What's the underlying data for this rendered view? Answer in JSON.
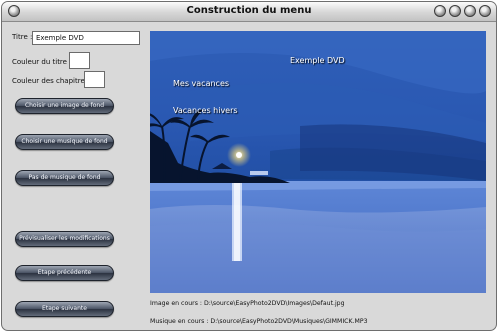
{
  "window": {
    "title": "Construction du menu"
  },
  "form": {
    "titre_label": "Titre :",
    "titre_value": "Exemple DVD",
    "couleur_titre_label": "Couleur du titre :",
    "couleur_chapitres_label": "Couleur des chapitres :",
    "couleur_titre_value": "#ffffff",
    "couleur_chapitres_value": "#ffffff"
  },
  "buttons": {
    "choose_image": "Choisir une image de fond",
    "choose_music": "Choisir une musique de fond",
    "no_music": "Pas de musique de fond",
    "preview": "Prévisualiser les modifications",
    "prev_step": "Etape précédente",
    "next_step": "Etape suivante"
  },
  "preview": {
    "menu_title": "Exemple DVD",
    "chapters": [
      "Mes vacances",
      "Vacances hivers"
    ]
  },
  "status": {
    "image_label": "Image en cours :",
    "image_path": "D:\\source\\EasyPhoto2DVD\\Images\\Defaut.jpg",
    "music_label": "Musique en cours :",
    "music_path": "D:\\source\\EasyPhoto2DVD\\Musiques\\GIMMICK.MP3"
  }
}
